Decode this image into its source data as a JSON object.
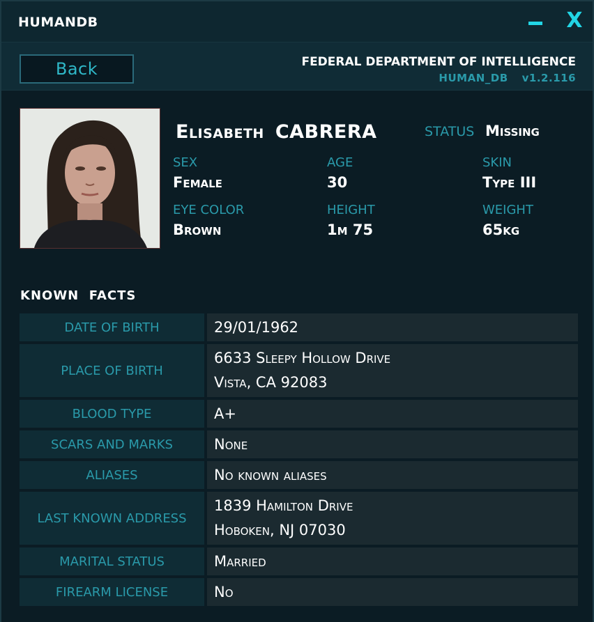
{
  "window": {
    "title": "HUMANDB",
    "minimize_icon": "minimize-icon",
    "close_label": "X"
  },
  "header": {
    "back_label": "Back",
    "agency": "FEDERAL DEPARTMENT OF INTELLIGENCE",
    "db_name": "HUMAN_DB",
    "version": "v1.2.116"
  },
  "profile": {
    "first_name": "Elisabeth",
    "last_name": "CABRERA",
    "status_label": "STATUS",
    "status_value": "Missing",
    "attributes": [
      {
        "label": "SEX",
        "value": "Female"
      },
      {
        "label": "AGE",
        "value": "30"
      },
      {
        "label": "SKIN",
        "value": "Type III"
      },
      {
        "label": "EYE COLOR",
        "value": "Brown"
      },
      {
        "label": "HEIGHT",
        "value": "1m 75"
      },
      {
        "label": "WEIGHT",
        "value": "65kg"
      }
    ]
  },
  "facts": {
    "title": "KNOWN  FACTS",
    "rows": [
      {
        "label": "DATE OF BIRTH",
        "line1": "29/01/1962",
        "line2": ""
      },
      {
        "label": "PLACE OF BIRTH",
        "line1": "6633 Sleepy Hollow Drive",
        "line2": "Vista, CA 92083"
      },
      {
        "label": "BLOOD TYPE",
        "line1": "A+",
        "line2": ""
      },
      {
        "label": "SCARS AND MARKS",
        "line1": "None",
        "line2": ""
      },
      {
        "label": "ALIASES",
        "line1": "No known aliases",
        "line2": ""
      },
      {
        "label": "LAST KNOWN ADDRESS",
        "line1": "1839 Hamilton Drive",
        "line2": "Hoboken, NJ 07030"
      },
      {
        "label": "MARITAL STATUS",
        "line1": "Married",
        "line2": ""
      },
      {
        "label": "FIREARM LICENSE",
        "line1": "No",
        "line2": ""
      }
    ]
  },
  "colors": {
    "accent": "#22d6e6",
    "label": "#2a9aaa",
    "panel": "#0f2c35",
    "value_panel": "#1b2a30"
  }
}
